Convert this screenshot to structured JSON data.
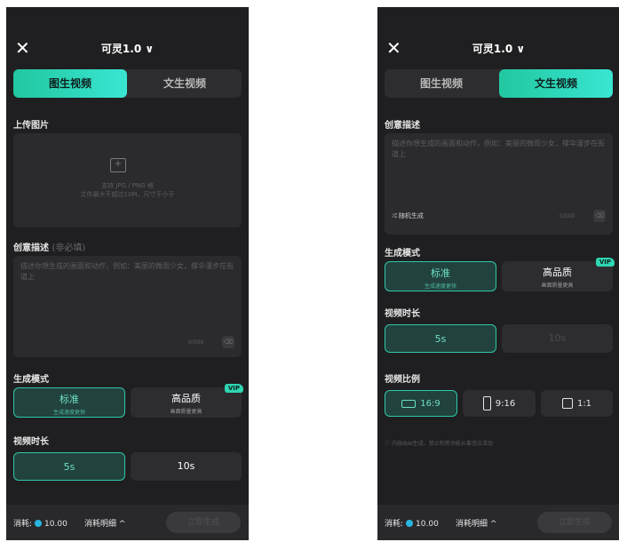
{
  "image_gen": {
    "title": "可灵1.0 ∨",
    "tabs": [
      "图生视频",
      "文生视频"
    ],
    "upload_label": "上传图片",
    "upload_hint_1": "支持 JPG / PNG 格",
    "upload_hint_2": "文件最大不超过10M，尺寸于小于",
    "desc_label": "创意描述",
    "desc_optional": "(非必填)",
    "desc_placeholder": "描述你想生成的画面和动作，例如：美丽的微雨少女，撑伞漫步在街道上",
    "desc_count": "0/500",
    "mode_label": "生成模式",
    "modes": [
      {
        "title": "标准",
        "sub": "生成速度更快"
      },
      {
        "title": "高品质",
        "sub": "画面质量更高",
        "badge": "VIP"
      }
    ],
    "duration_label": "视频时长",
    "durations": [
      "5s",
      "10s"
    ],
    "cost_label": "消耗:",
    "cost_value": "10.00",
    "detail_label": "消耗明细 ^",
    "generate_label": "立即生成"
  },
  "text_gen": {
    "title": "可灵1.0 ∨",
    "tabs": [
      "图生视频",
      "文生视频"
    ],
    "desc_label": "创意描述",
    "desc_placeholder": "描述你想生成的画面和动作，例如：美丽的微雨少女，撑伞漫步在街道上",
    "random_label": "随机生成",
    "desc_count": "0/500",
    "mode_label": "生成模式",
    "modes": [
      {
        "title": "标准",
        "sub": "生成速度更快"
      },
      {
        "title": "高品质",
        "sub": "画面质量更高",
        "badge": "VIP"
      }
    ],
    "duration_label": "视频时长",
    "durations": [
      "5s",
      "10s"
    ],
    "ratio_label": "视频比例",
    "ratios": [
      "16:9",
      "9:16",
      "1:1"
    ],
    "tip": "内容由AI生成，禁止利用功能从事违法活动",
    "cost_label": "消耗:",
    "cost_value": "10.00",
    "detail_label": "消耗明细 ^",
    "generate_label": "立即生成"
  },
  "colors": {
    "accent": "#2fc8a8",
    "bg": "#1f1f21",
    "panel": "#2d2d30"
  }
}
